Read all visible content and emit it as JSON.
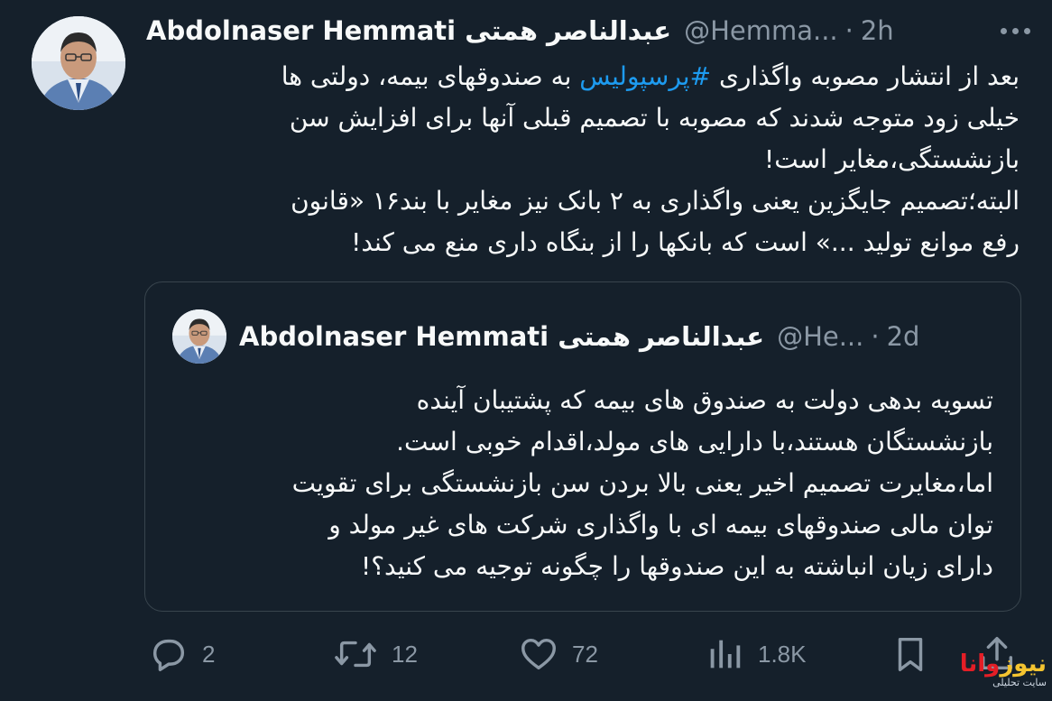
{
  "tweet": {
    "author_name": "Abdolnaser Hemmati عبدالناصر همتی",
    "handle": "@Hemma...",
    "separator": "·",
    "time": "2h",
    "body_line1_prefix": "بعد از انتشار مصوبه واگذاری ",
    "hashtag": "#پرسپولیس",
    "body_line1_suffix": " به صندوقهای بیمه، دولتی ها",
    "body_line2": "خیلی زود متوجه شدند که مصوبه با تصمیم قبلی آنها برای افزایش سن",
    "body_line3": "بازنشستگی،مغایر است!",
    "body_line4": "البته؛تصمیم جایگزین یعنی واگذاری به ۲ بانک نیز مغایر با بند۱۶ «قانون",
    "body_line5": "رفع موانع تولید ...» است که بانکها را از بنگاه داری منع می کند!"
  },
  "quote": {
    "author_name": "Abdolnaser Hemmati عبدالناصر همتی",
    "handle": "@He...",
    "separator": "·",
    "time": "2d",
    "line1": "تسویه بدهی دولت به صندوق های بیمه که پشتیبان آینده",
    "line2": "بازنشستگان هستند،با دارایی های مولد،اقدام خوبی است.",
    "line3": "اما،مغایرت تصمیم اخیر یعنی بالا بردن سن بازنشستگی برای تقویت",
    "line4": "توان مالی صندوقهای بیمه ای با واگذاری شرکت های غیر مولد و",
    "line5": "دارای زیان انباشته به این صندوقها را چگونه توجیه می کنید؟!"
  },
  "actions": {
    "replies": "2",
    "retweets": "12",
    "likes": "72",
    "views": "1.8K"
  },
  "watermark": {
    "logo_main": "وانا",
    "logo_accent": "نیوز",
    "subtitle": "سایت تحلیلی"
  },
  "icons": {
    "reply": "reply-icon",
    "retweet": "retweet-icon",
    "like": "heart-icon",
    "views": "views-icon",
    "bookmark": "bookmark-icon",
    "share": "share-icon",
    "more": "more-icon"
  },
  "colors": {
    "background": "#15202b",
    "text": "#f7f9f9",
    "muted": "#8b98a5",
    "link": "#1d9bf0",
    "border": "#38444d"
  }
}
